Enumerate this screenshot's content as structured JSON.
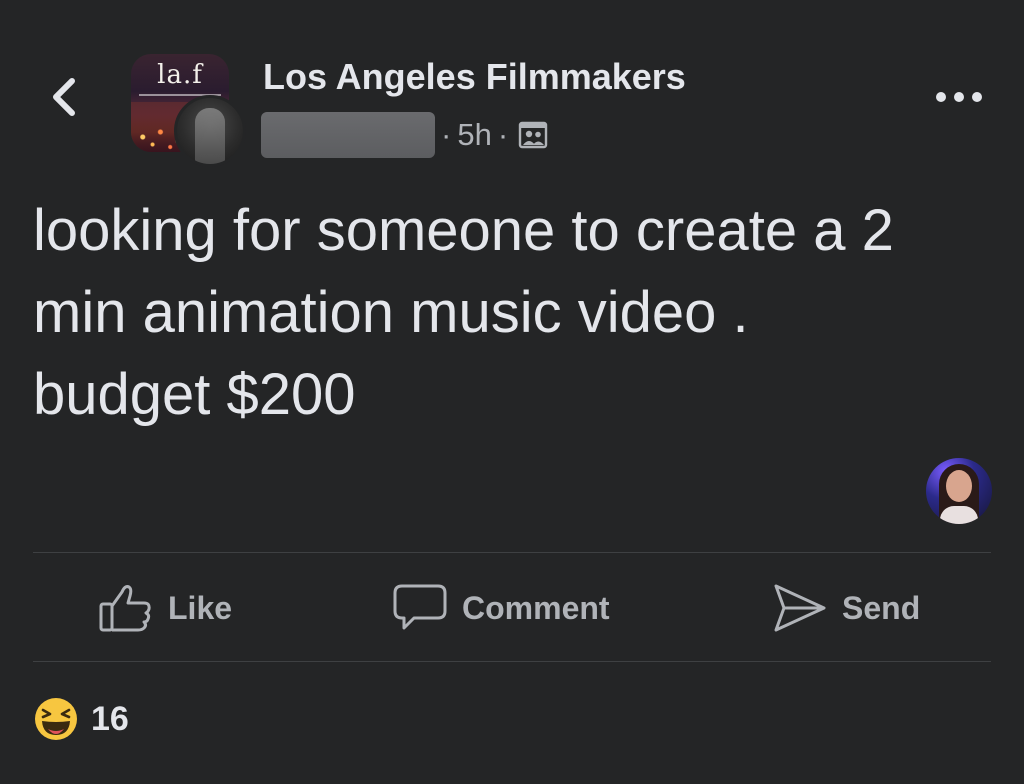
{
  "header": {
    "group_name": "Los Angeles Filmmakers",
    "group_logo_text": "la.f",
    "timestamp": "5h",
    "separator": "·",
    "audience_icon": "group-audience-icon",
    "back_icon": "chevron-left-icon",
    "more_icon": "more-horizontal-icon"
  },
  "post": {
    "text": "looking for someone to create a 2\nmin animation music video .\nbudget $200"
  },
  "actions": {
    "like_label": "Like",
    "comment_label": "Comment",
    "send_label": "Send"
  },
  "reactions": {
    "emoji": "haha-reaction-icon",
    "count": "16"
  },
  "colors": {
    "background": "#242526",
    "primary_text": "#e4e6eb",
    "secondary_text": "#b0b3b8",
    "divider": "#3e4042",
    "haha_yellow": "#f7c640"
  }
}
